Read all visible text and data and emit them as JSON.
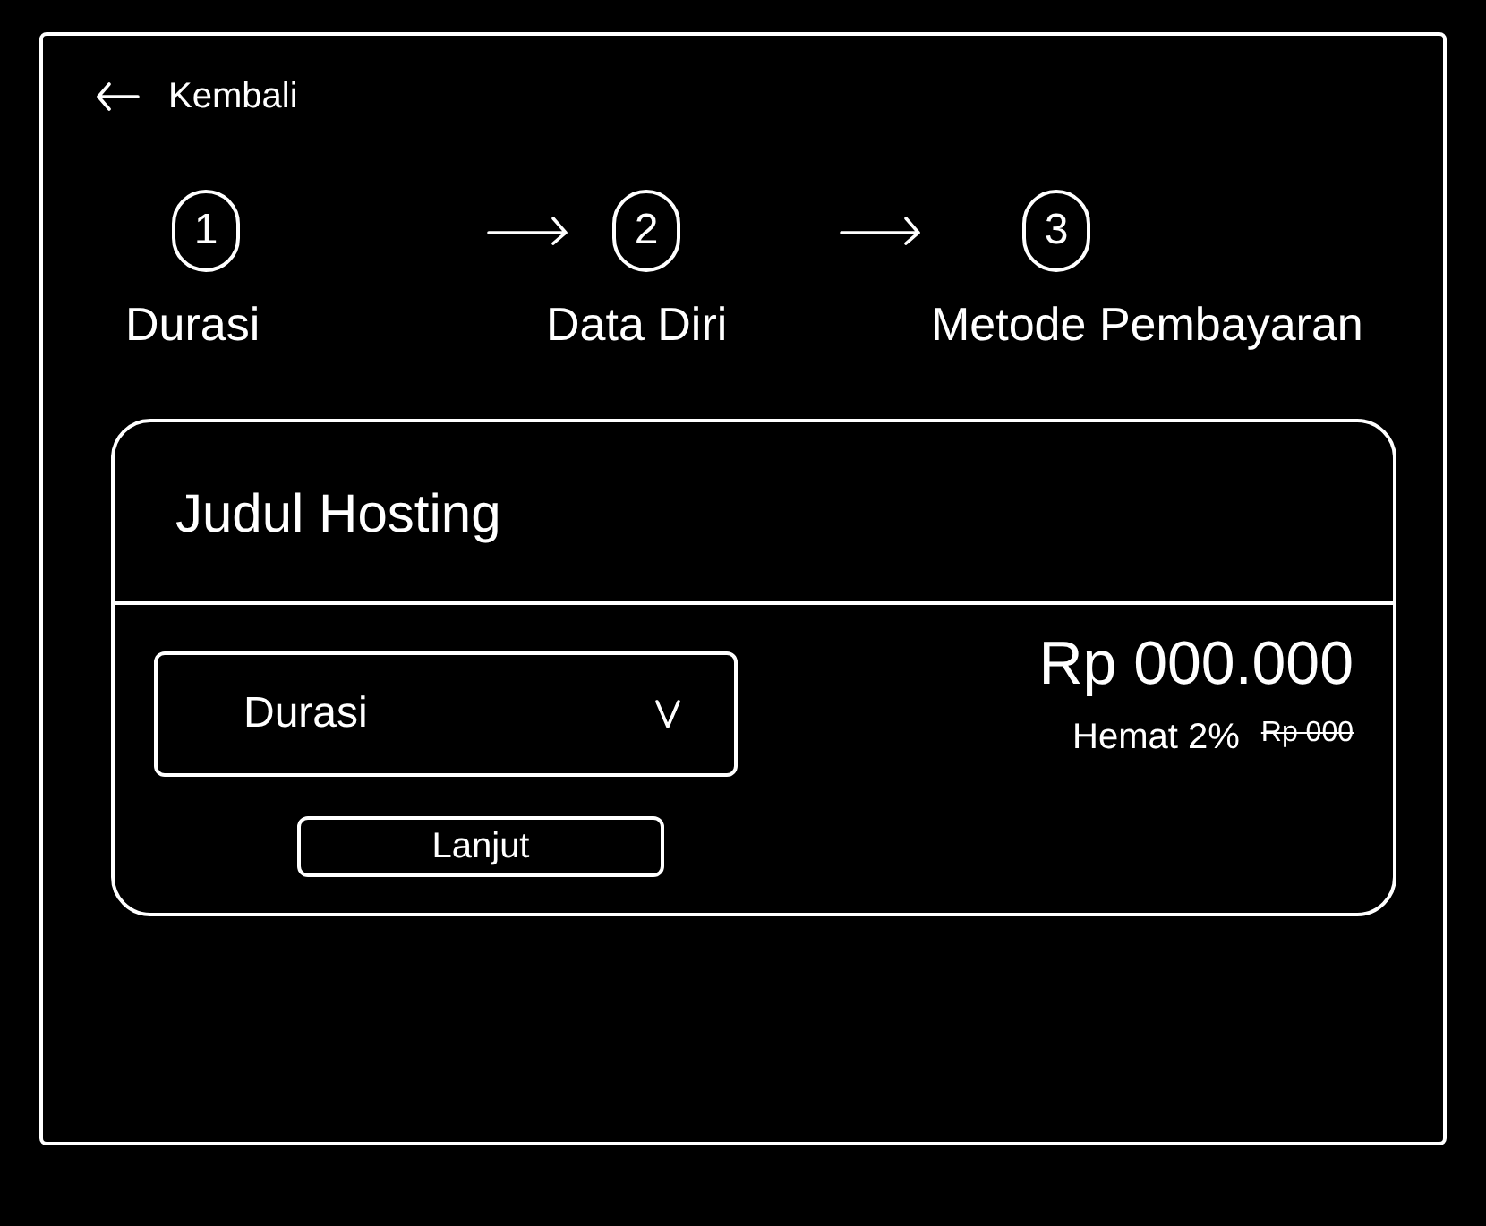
{
  "back_link": {
    "label": "Kembali"
  },
  "steps": [
    {
      "number": "1",
      "label": "Durasi"
    },
    {
      "number": "2",
      "label": "Data Diri"
    },
    {
      "number": "3",
      "label": "Metode Pembayaran"
    }
  ],
  "card": {
    "title": "Judul Hosting",
    "duration_select": {
      "placeholder": "Durasi"
    },
    "price": "Rp 000.000",
    "savings": {
      "label": "Hemat 2%",
      "original_price": "Rp 000"
    },
    "button": "Lanjut"
  }
}
